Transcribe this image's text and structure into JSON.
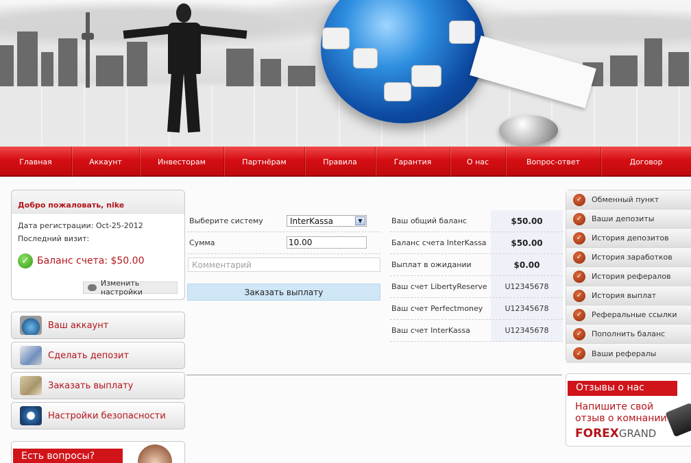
{
  "nav": {
    "items": [
      "Главная",
      "Аккаунт",
      "Инвесторам",
      "Партнёрам",
      "Правила",
      "Гарантия",
      "О нас",
      "Вопрос-ответ",
      "Договор"
    ]
  },
  "welcome": {
    "title": "Добро пожаловать, nike",
    "reg_date": "Дата регистрации: Oct-25-2012",
    "last_visit": "Последний визит:",
    "balance": "Баланс счета: $50.00",
    "settings_label": "Изменить настройки"
  },
  "left_menu": {
    "account": "Ваш аккаунт",
    "deposit": "Сделать депозит",
    "withdraw": "Заказать выплату",
    "security": "Настройки безопасности"
  },
  "questions_banner": "Есть вопросы?",
  "form": {
    "system_label": "Выберите систему",
    "system_value": "InterKassa",
    "sum_label": "Сумма",
    "sum_value": "10.00",
    "comment_placeholder": "Комментарий",
    "submit_label": "Заказать выплату"
  },
  "stats": [
    {
      "label": "Ваш общий баланс",
      "value": "$50.00"
    },
    {
      "label": "Баланс счета InterKassa",
      "value": "$50.00"
    },
    {
      "label": "Выплат в ожидании",
      "value": "$0.00"
    },
    {
      "label": "Ваш счет LibertyReserve",
      "value": "U12345678"
    },
    {
      "label": "Ваш счет Perfectmoney",
      "value": "U12345678"
    },
    {
      "label": "Ваш счет InterKassa",
      "value": "U12345678"
    }
  ],
  "right_menu": [
    "Обменный пункт",
    "Ваши депозиты",
    "История депозитов",
    "История заработков",
    "История рефералов",
    "История выплат",
    "Реферальные ссылки",
    "Пополнить баланс",
    "Ваши рефералы"
  ],
  "reviews": {
    "tag": "Отзывы о нас",
    "line1": "Напишите свой",
    "line2": "отзыв о комнании",
    "logo_bold": "FOREX",
    "logo_light": "GRAND"
  },
  "colors": {
    "accent": "#d0141a",
    "nav": "#d60f14",
    "text_red": "#b3141a"
  }
}
